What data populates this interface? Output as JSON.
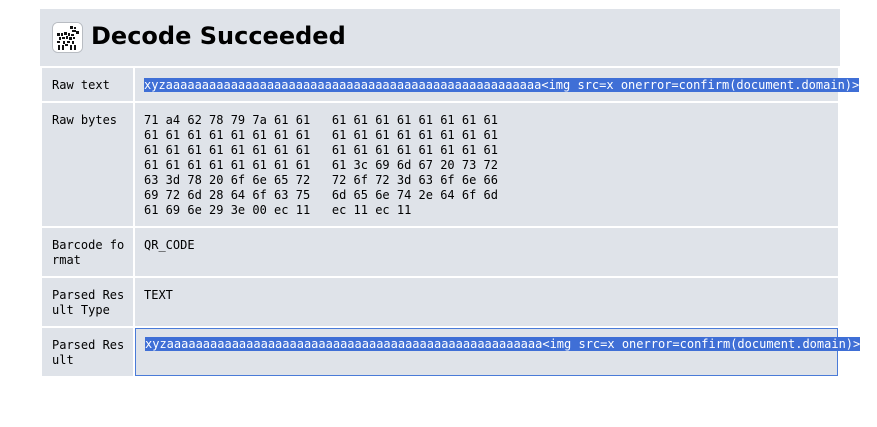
{
  "header": {
    "title": "Decode Succeeded",
    "logo_icon": "zxing-barcode-logo-icon"
  },
  "rows": [
    {
      "label": "Raw text",
      "value": "xyzaaaaaaaaaaaaaaaaaaaaaaaaaaaaaaaaaaaaaaaaaaaaaaaaaaaa<img src=x onerror=confirm(document.domain)>"
    },
    {
      "label": "Raw bytes",
      "value": "71 a4 62 78 79 7a 61 61   61 61 61 61 61 61 61 61\n61 61 61 61 61 61 61 61   61 61 61 61 61 61 61 61\n61 61 61 61 61 61 61 61   61 61 61 61 61 61 61 61\n61 61 61 61 61 61 61 61   61 3c 69 6d 67 20 73 72\n63 3d 78 20 6f 6e 65 72   72 6f 72 3d 63 6f 6e 66\n69 72 6d 28 64 6f 63 75   6d 65 6e 74 2e 64 6f 6d\n61 69 6e 29 3e 00 ec 11   ec 11 ec 11"
    },
    {
      "label": "Barcode format",
      "value": "QR_CODE"
    },
    {
      "label": "Parsed Result Type",
      "value": "TEXT"
    },
    {
      "label": "Parsed Result",
      "value": "xyzaaaaaaaaaaaaaaaaaaaaaaaaaaaaaaaaaaaaaaaaaaaaaaaaaaaa<img src=x onerror=confirm(document.domain)>"
    }
  ],
  "colors": {
    "panel_bg": "#dfe3e9",
    "selection": "#3f6fd6",
    "focus_border": "#4a7bd8"
  }
}
